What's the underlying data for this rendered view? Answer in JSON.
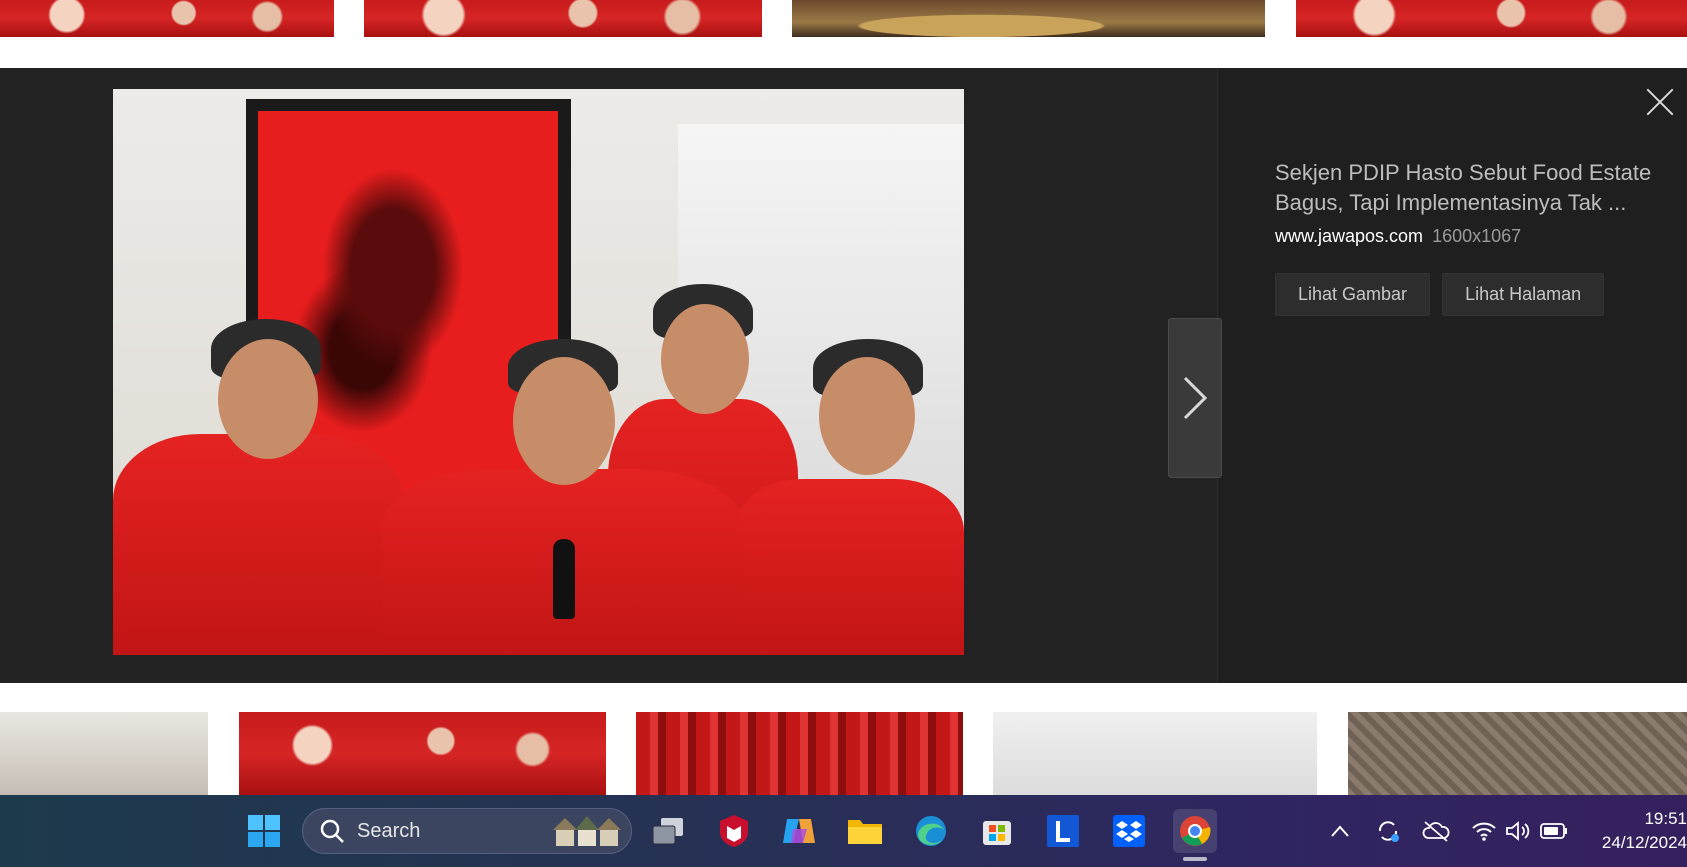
{
  "detail": {
    "title": "Sekjen PDIP Hasto Sebut Food Estate Bagus, Tapi Implementasinya Tak ...",
    "domain": "www.jawapos.com",
    "dimensions": "1600x1067",
    "buttons": {
      "view_image": "Lihat Gambar",
      "view_page": "Lihat Halaman"
    }
  },
  "taskbar": {
    "search_label": "Search",
    "clock": {
      "time": "19:51",
      "date": "24/12/2024"
    }
  },
  "colors": {
    "viewer_bg": "#222222",
    "pdip_red": "#e52222",
    "taskbar_start": "#1d3a4c",
    "taskbar_end": "#35205e"
  }
}
